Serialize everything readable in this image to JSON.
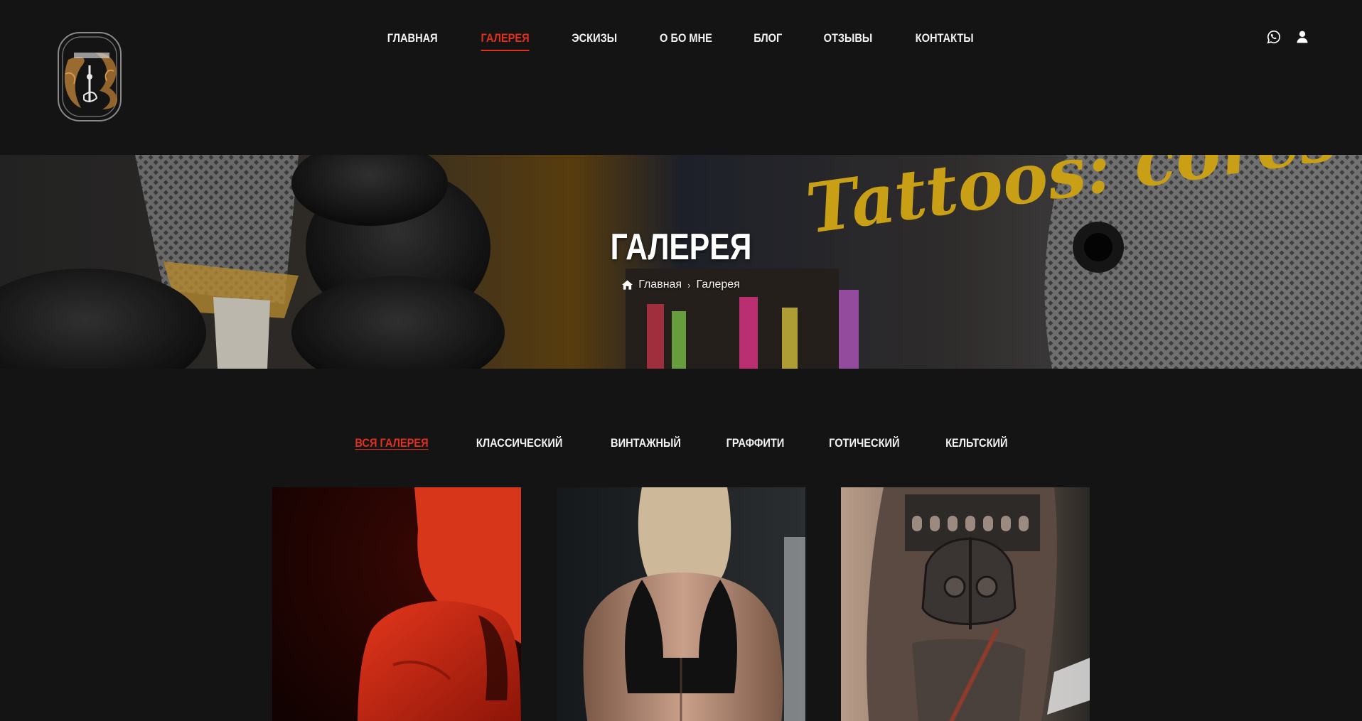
{
  "header": {
    "logo_icon": "tattoo-studio-monogram-logo",
    "nav": [
      {
        "label": "ГЛАВНАЯ",
        "active": false
      },
      {
        "label": "ГАЛЕРЕЯ",
        "active": true
      },
      {
        "label": "ЭСКИЗЫ",
        "active": false
      },
      {
        "label": "О БО МНЕ",
        "active": false
      },
      {
        "label": "БЛОГ",
        "active": false
      },
      {
        "label": "ОТЗЫВЫ",
        "active": false
      },
      {
        "label": "КОНТАКТЫ",
        "active": false
      }
    ],
    "icons": [
      "whatsapp-icon",
      "user-icon"
    ]
  },
  "hero": {
    "title": "ГАЛЕРЕЯ",
    "breadcrumb": {
      "home_icon": "home-icon",
      "items": [
        "Главная",
        "Галерея"
      ]
    },
    "background_text": "Tattoos: cores da"
  },
  "filters": [
    {
      "label": "ВСЯ ГАЛЕРЕЯ",
      "active": true
    },
    {
      "label": "КЛАССИЧЕСКИЙ",
      "active": false
    },
    {
      "label": "ВИНТАЖНЫЙ",
      "active": false
    },
    {
      "label": "ГРАФФИТИ",
      "active": false
    },
    {
      "label": "ГОТИЧЕСКИЙ",
      "active": false
    },
    {
      "label": "КЕЛЬТСКИЙ",
      "active": false
    }
  ],
  "gallery": [
    {
      "image": "red-haired-woman-back-red-light"
    },
    {
      "image": "blonde-woman-back-black-sports-top"
    },
    {
      "image": "gladiator-helmet-sleeve-tattoo"
    }
  ],
  "colors": {
    "background": "#141414",
    "accent": "#e2301c",
    "text": "#f2f2f2",
    "hero_script": "#f6c21c"
  }
}
